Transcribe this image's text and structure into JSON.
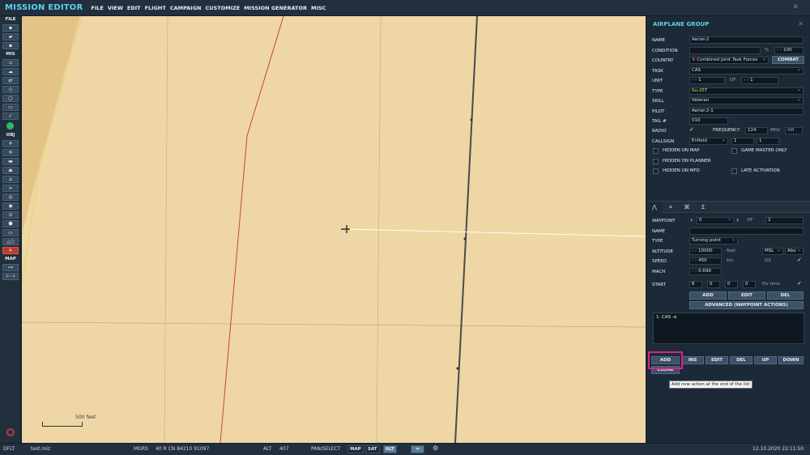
{
  "app_title": "MISSION EDITOR",
  "menu": [
    "FILE",
    "VIEW",
    "EDIT",
    "FLIGHT",
    "CAMPAIGN",
    "CUSTOMIZE",
    "MISSION GENERATOR",
    "MISC"
  ],
  "toolbar": {
    "file_label": "FILE",
    "mis_label": "MIS",
    "obj_label": "OBJ",
    "map_label": "MAP"
  },
  "map": {
    "scale_label": "500 feet"
  },
  "panel": {
    "title": "AIRPLANE GROUP",
    "name_label": "NAME",
    "name_value": "Aerial-2",
    "condition_label": "CONDITION",
    "condition_unit": "%",
    "condition_value": "100",
    "country_label": "COUNTRY",
    "country_value": "Combined Joint Task Forces",
    "combat_button": "COMBAT",
    "task_label": "TASK",
    "task_value": "CAS",
    "unit_label": "UNIT",
    "unit_value": "1",
    "unit_of": "OF",
    "unit_total": "1",
    "type_label": "TYPE",
    "type_value": "Su-25T",
    "skill_label": "SKILL",
    "skill_value": "Veteran",
    "pilot_label": "PILOT",
    "pilot_value": "Aerial-2-1",
    "tail_label": "TAIL #",
    "tail_value": "010",
    "radio_label": "RADIO",
    "frequency_label": "FREQUENCY",
    "frequency_value": "124",
    "frequency_unit": "MHz",
    "modulation": "AM",
    "callsign_label": "CALLSIGN",
    "callsign_value": "Enfield",
    "callsign_n1": "1",
    "callsign_n2": "1",
    "hidden_on_map": "HIDDEN ON MAP",
    "game_master_only": "GAME MASTER ONLY",
    "hidden_on_planner": "HIDDEN ON PLANNER",
    "hidden_on_mfd": "HIDDEN ON MFD",
    "late_activation": "LATE ACTIVATION"
  },
  "waypoint": {
    "waypoint_label": "WAYPOINT",
    "waypoint_value": "0",
    "of_label": "OF",
    "waypoint_total": "2",
    "name_label": "NAME",
    "name_value": "",
    "type_label": "TYPE",
    "type_value": "Turning point",
    "altitude_label": "ALTITUDE",
    "altitude_value": "10000",
    "altitude_unit": "feet",
    "altitude_ref": "MSL",
    "altitude_ref2": "Abo",
    "speed_label": "SPEED",
    "speed_value": "450",
    "speed_unit": "kts",
    "gs_label": "GS",
    "mach_label": "MACH",
    "mach_value": "0.699",
    "start_label": "START",
    "start_d": "8",
    "start_h": "0",
    "start_m": "0",
    "start_s": "0",
    "fix_time": "Fix time",
    "add_button": "ADD",
    "edit_button": "EDIT",
    "del_button": "DEL",
    "advanced_button": "ADVANCED (WAYPOINT ACTIONS)"
  },
  "actions": {
    "list": [
      "1. CAS -a"
    ],
    "add_button": "ADD",
    "ins_button": "INS",
    "edit_button": "EDIT",
    "del_button": "DEL",
    "up_button": "UP",
    "down_button": "DOWN",
    "clone_button": "CLONE",
    "tooltip": "Add new action at the end of the list"
  },
  "status": {
    "mode": "DFLT",
    "file": "test.miz",
    "coord_system": "MGRS",
    "coords": "40 R CN 84210 91097",
    "alt_label": "ALT",
    "alt_value": "407",
    "pan_select": "PAN/SELECT",
    "map_btn": "MAP",
    "sat_btn": "SAT",
    "alt_btn": "ALT",
    "datetime": "12.10.2020 22:11:50"
  },
  "colors": {
    "accent": "#5fd0f0",
    "map_bg": "#eed7a5",
    "highlight": "#e01f8f"
  }
}
